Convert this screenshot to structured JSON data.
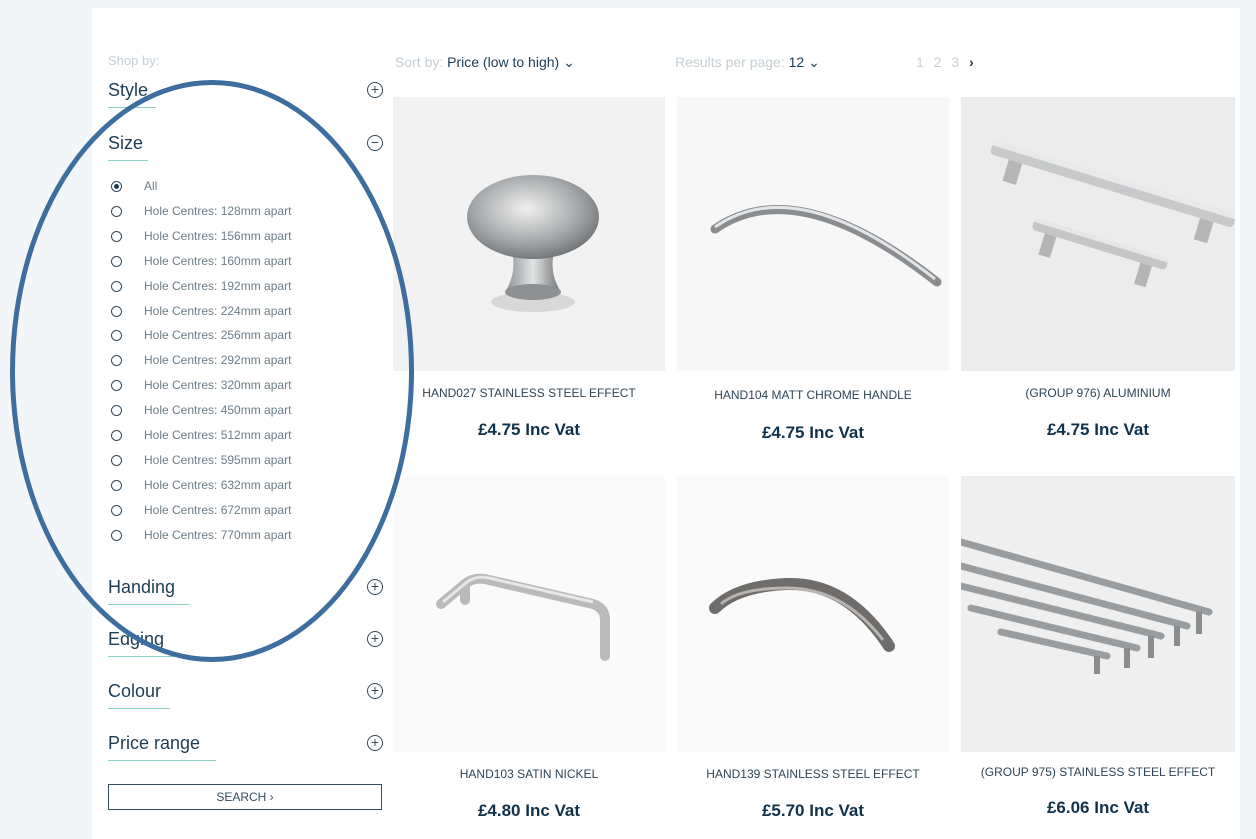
{
  "filters": {
    "shop_by_label": "Shop by:",
    "style": {
      "title": "Style",
      "toggle": "+"
    },
    "size": {
      "title": "Size",
      "toggle": "−",
      "options": [
        {
          "label": "All",
          "selected": true
        },
        {
          "label": "Hole Centres: 128mm apart",
          "selected": false
        },
        {
          "label": "Hole Centres: 156mm apart",
          "selected": false
        },
        {
          "label": "Hole Centres: 160mm apart",
          "selected": false
        },
        {
          "label": "Hole Centres: 192mm apart",
          "selected": false
        },
        {
          "label": "Hole Centres: 224mm apart",
          "selected": false
        },
        {
          "label": "Hole Centres: 256mm apart",
          "selected": false
        },
        {
          "label": "Hole Centres: 292mm apart",
          "selected": false
        },
        {
          "label": "Hole Centres: 320mm apart",
          "selected": false
        },
        {
          "label": "Hole Centres: 450mm apart",
          "selected": false
        },
        {
          "label": "Hole Centres: 512mm apart",
          "selected": false
        },
        {
          "label": "Hole Centres: 595mm apart",
          "selected": false
        },
        {
          "label": "Hole Centres: 632mm apart",
          "selected": false
        },
        {
          "label": "Hole Centres: 672mm apart",
          "selected": false
        },
        {
          "label": "Hole Centres: 770mm apart",
          "selected": false
        }
      ]
    },
    "handing": {
      "title": "Handing",
      "toggle": "+"
    },
    "edging": {
      "title": "Edging",
      "toggle": "+"
    },
    "colour": {
      "title": "Colour",
      "toggle": "+"
    },
    "price_range": {
      "title": "Price range",
      "toggle": "+"
    },
    "search_label": "SEARCH ›"
  },
  "toolbar": {
    "sort_label": "Sort by:",
    "sort_value": "Price (low to high) ⌄",
    "per_page_label": "Results per page:",
    "per_page_value": "12 ⌄",
    "pages": [
      "1",
      "2",
      "3"
    ],
    "next": "›"
  },
  "products": [
    {
      "name": "HAND027 STAINLESS STEEL EFFECT",
      "price": "£4.75 Inc Vat",
      "icon": "round-knob-icon"
    },
    {
      "name": "HAND104 MATT CHROME HANDLE",
      "price": "£4.75 Inc Vat",
      "icon": "bow-handle-icon"
    },
    {
      "name": "(GROUP 976) ALUMINIUM",
      "price": "£4.75 Inc Vat",
      "icon": "bar-handle-icon"
    },
    {
      "name": "HAND103 SATIN NICKEL",
      "price": "£4.80 Inc Vat",
      "icon": "d-handle-icon"
    },
    {
      "name": "HAND139 STAINLESS STEEL EFFECT",
      "price": "£5.70 Inc Vat",
      "icon": "bow-handle-icon"
    },
    {
      "name": "(GROUP 975) STAINLESS STEEL EFFECT",
      "price": "£6.06 Inc Vat",
      "icon": "t-bar-handle-icon"
    }
  ],
  "colors": {
    "accent_rule": "#8ccfc7",
    "heading": "#1d3d55",
    "annotation_circle": "#3d6e9f"
  }
}
